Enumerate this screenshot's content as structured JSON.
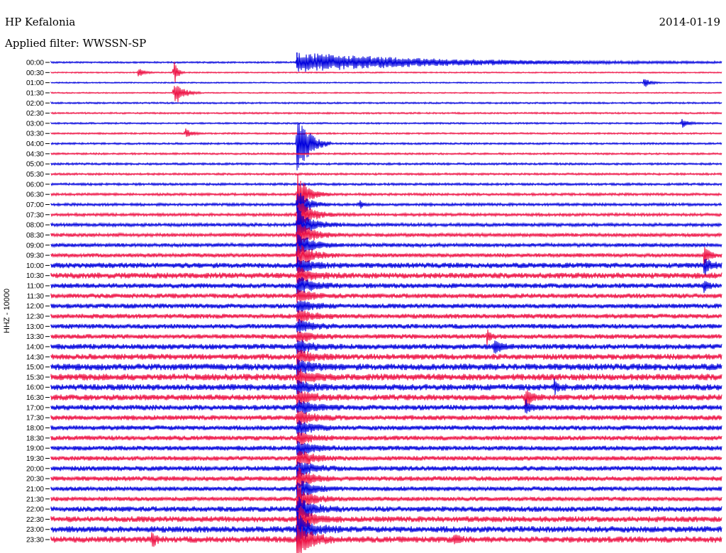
{
  "header": {
    "station": "HP Kefalonia",
    "date": "2014-01-19",
    "filter_label": "Applied filter: WWSSN-SP"
  },
  "chart_data": {
    "type": "line",
    "subtype": "helicorder",
    "ylabel": "HHZ - 10000",
    "tick_labels": [
      "00:00",
      "00:30",
      "01:00",
      "01:30",
      "02:00",
      "02:30",
      "03:00",
      "03:30",
      "04:00",
      "04:30",
      "05:00",
      "05:30",
      "06:00",
      "06:30",
      "07:00",
      "07:30",
      "08:00",
      "08:30",
      "09:00",
      "09:30",
      "10:00",
      "10:30",
      "11:00",
      "11:30",
      "12:00",
      "12:30",
      "13:00",
      "13:30",
      "14:00",
      "14:30",
      "15:00",
      "15:30",
      "16:00",
      "16:30",
      "17:00",
      "17:30",
      "18:00",
      "18:30",
      "19:00",
      "19:30",
      "20:00",
      "20:30",
      "21:00",
      "21:30",
      "22:00",
      "22:30",
      "23:00",
      "23:30"
    ],
    "trace_colors": [
      "#0000dd",
      "#ee1144"
    ],
    "trace_color_rule": "alternating by trace, starting with blue at 00:00",
    "x_range_minutes": [
      0,
      30
    ],
    "noise_level_per_trace": [
      0.8,
      0.6,
      0.6,
      0.6,
      0.8,
      0.8,
      0.8,
      0.8,
      0.9,
      0.9,
      1.0,
      1.0,
      1.1,
      1.2,
      1.3,
      1.4,
      1.6,
      1.7,
      1.8,
      1.9,
      2.6,
      2.8,
      2.4,
      2.3,
      2.3,
      2.3,
      2.3,
      2.3,
      2.6,
      2.8,
      3.2,
      3.2,
      3.0,
      2.8,
      2.6,
      2.4,
      2.3,
      2.3,
      2.3,
      2.2,
      2.4,
      2.3,
      2.2,
      2.1,
      2.6,
      2.8,
      3.0,
      3.0
    ],
    "events": [
      {
        "trace": 0,
        "minute": 11.0,
        "amplitude": 14,
        "duration_min": 20,
        "color": "#0000dd"
      },
      {
        "trace": 1,
        "minute": 3.9,
        "amplitude": 7,
        "duration_min": 0.8
      },
      {
        "trace": 1,
        "minute": 5.5,
        "amplitude": 24,
        "duration_min": 0.5
      },
      {
        "trace": 2,
        "minute": 26.5,
        "amplitude": 8,
        "duration_min": 0.8
      },
      {
        "trace": 3,
        "minute": 5.5,
        "amplitude": 22,
        "duration_min": 1.2
      },
      {
        "trace": 6,
        "minute": 28.2,
        "amplitude": 8,
        "duration_min": 0.8
      },
      {
        "trace": 7,
        "minute": 6.0,
        "amplitude": 8,
        "duration_min": 0.8
      },
      {
        "trace": 8,
        "minute": 11.0,
        "amplitude": 60,
        "duration_min": 1.5
      },
      {
        "trace": 13,
        "minute": 11.0,
        "amplitude": 30,
        "duration_min": 1.5
      },
      {
        "trace": 14,
        "minute": 11.0,
        "amplitude": 25,
        "duration_min": 1.5
      },
      {
        "trace": 14,
        "minute": 13.8,
        "amplitude": 8,
        "duration_min": 0.4
      },
      {
        "trace": 15,
        "minute": 11.0,
        "amplitude": 28,
        "duration_min": 1.8
      },
      {
        "trace": 16,
        "minute": 11.0,
        "amplitude": 24,
        "duration_min": 2.0
      },
      {
        "trace": 17,
        "minute": 11.0,
        "amplitude": 22,
        "duration_min": 2.0
      },
      {
        "trace": 18,
        "minute": 11.0,
        "amplitude": 20,
        "duration_min": 2.0
      },
      {
        "trace": 19,
        "minute": 11.0,
        "amplitude": 20,
        "duration_min": 2.0
      },
      {
        "trace": 19,
        "minute": 29.2,
        "amplitude": 14,
        "duration_min": 0.8
      },
      {
        "trace": 20,
        "minute": 11.0,
        "amplitude": 12,
        "duration_min": 2.0
      },
      {
        "trace": 20,
        "minute": 29.2,
        "amplitude": 16,
        "duration_min": 0.8
      },
      {
        "trace": 21,
        "minute": 11.0,
        "amplitude": 12,
        "duration_min": 2.0
      },
      {
        "trace": 22,
        "minute": 11.0,
        "amplitude": 14,
        "duration_min": 2.0
      },
      {
        "trace": 22,
        "minute": 29.2,
        "amplitude": 10,
        "duration_min": 0.6
      },
      {
        "trace": 23,
        "minute": 11.0,
        "amplitude": 10,
        "duration_min": 2.0
      },
      {
        "trace": 24,
        "minute": 11.0,
        "amplitude": 10,
        "duration_min": 2.0
      },
      {
        "trace": 25,
        "minute": 11.0,
        "amplitude": 10,
        "duration_min": 2.0
      },
      {
        "trace": 26,
        "minute": 11.0,
        "amplitude": 10,
        "duration_min": 2.0
      },
      {
        "trace": 27,
        "minute": 11.0,
        "amplitude": 10,
        "duration_min": 2.0
      },
      {
        "trace": 27,
        "minute": 19.5,
        "amplitude": 10,
        "duration_min": 0.5
      },
      {
        "trace": 28,
        "minute": 11.0,
        "amplitude": 10,
        "duration_min": 2.0
      },
      {
        "trace": 28,
        "minute": 19.8,
        "amplitude": 14,
        "duration_min": 0.8
      },
      {
        "trace": 29,
        "minute": 11.0,
        "amplitude": 10,
        "duration_min": 2.0
      },
      {
        "trace": 30,
        "minute": 11.0,
        "amplitude": 10,
        "duration_min": 2.0
      },
      {
        "trace": 31,
        "minute": 11.0,
        "amplitude": 10,
        "duration_min": 2.0
      },
      {
        "trace": 32,
        "minute": 11.0,
        "amplitude": 10,
        "duration_min": 2.0
      },
      {
        "trace": 32,
        "minute": 22.5,
        "amplitude": 10,
        "duration_min": 0.6
      },
      {
        "trace": 33,
        "minute": 11.0,
        "amplitude": 10,
        "duration_min": 2.0
      },
      {
        "trace": 33,
        "minute": 21.2,
        "amplitude": 16,
        "duration_min": 0.8
      },
      {
        "trace": 34,
        "minute": 11.0,
        "amplitude": 10,
        "duration_min": 2.0
      },
      {
        "trace": 34,
        "minute": 21.2,
        "amplitude": 12,
        "duration_min": 0.8
      },
      {
        "trace": 35,
        "minute": 11.0,
        "amplitude": 12,
        "duration_min": 2.0
      },
      {
        "trace": 36,
        "minute": 11.0,
        "amplitude": 12,
        "duration_min": 2.0
      },
      {
        "trace": 37,
        "minute": 11.0,
        "amplitude": 12,
        "duration_min": 2.0
      },
      {
        "trace": 38,
        "minute": 11.0,
        "amplitude": 12,
        "duration_min": 2.0
      },
      {
        "trace": 39,
        "minute": 11.0,
        "amplitude": 14,
        "duration_min": 2.0
      },
      {
        "trace": 40,
        "minute": 11.0,
        "amplitude": 14,
        "duration_min": 2.0
      },
      {
        "trace": 41,
        "minute": 11.0,
        "amplitude": 16,
        "duration_min": 2.0
      },
      {
        "trace": 42,
        "minute": 11.0,
        "amplitude": 16,
        "duration_min": 2.0
      },
      {
        "trace": 43,
        "minute": 11.0,
        "amplitude": 18,
        "duration_min": 2.0
      },
      {
        "trace": 44,
        "minute": 11.0,
        "amplitude": 20,
        "duration_min": 2.0
      },
      {
        "trace": 45,
        "minute": 11.0,
        "amplitude": 22,
        "duration_min": 2.0
      },
      {
        "trace": 46,
        "minute": 11.0,
        "amplitude": 24,
        "duration_min": 2.0
      },
      {
        "trace": 47,
        "minute": 11.0,
        "amplitude": 26,
        "duration_min": 2.0
      },
      {
        "trace": 47,
        "minute": 4.5,
        "amplitude": 12,
        "duration_min": 0.6
      },
      {
        "trace": 47,
        "minute": 18.0,
        "amplitude": 10,
        "duration_min": 0.6
      }
    ]
  }
}
